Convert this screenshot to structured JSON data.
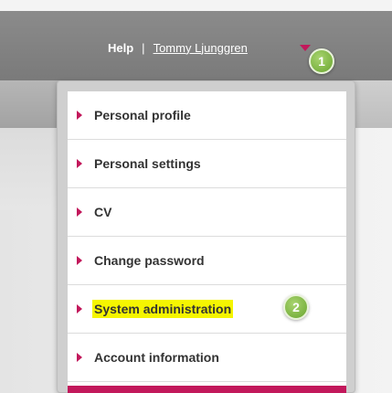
{
  "header": {
    "help_label": "Help",
    "separator": "|",
    "user_name": "Tommy Ljunggren"
  },
  "badges": {
    "step_1": "1",
    "step_2": "2"
  },
  "menu": {
    "items": [
      {
        "label": "Personal profile"
      },
      {
        "label": "Personal settings"
      },
      {
        "label": "CV"
      },
      {
        "label": "Change password"
      },
      {
        "label": "System administration",
        "highlighted": true
      },
      {
        "label": "Account information"
      }
    ]
  },
  "colors": {
    "accent": "#c2185b",
    "highlight": "#f5f500",
    "badge": "#7cb342",
    "header_bg": "#7f7f7f"
  },
  "icons": {
    "menu_bullet": "triangle-right-icon",
    "user_dropdown": "caret-down-icon"
  }
}
